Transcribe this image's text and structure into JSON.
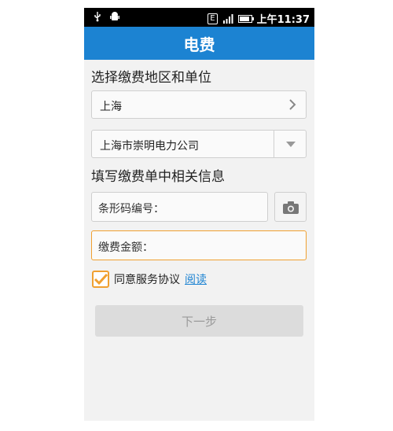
{
  "status": {
    "network_badge": "E",
    "time_label": "上午11:37",
    "left_icons": [
      "usb-icon",
      "android-icon"
    ]
  },
  "header": {
    "title": "电费"
  },
  "section1": {
    "title": "选择缴费地区和单位",
    "region": "上海",
    "company": "上海市崇明电力公司"
  },
  "section2": {
    "title": "填写缴费单中相关信息",
    "barcode_placeholder": "条形码编号：",
    "amount_placeholder": "缴费金额："
  },
  "agreement": {
    "label": "同意服务协议",
    "link": "阅读",
    "checked": true
  },
  "next_button": {
    "label": "下一步"
  },
  "colors": {
    "title_bar": "#1c83d2",
    "accent": "#f0a030",
    "disabled_button": "#dcdcdc"
  }
}
